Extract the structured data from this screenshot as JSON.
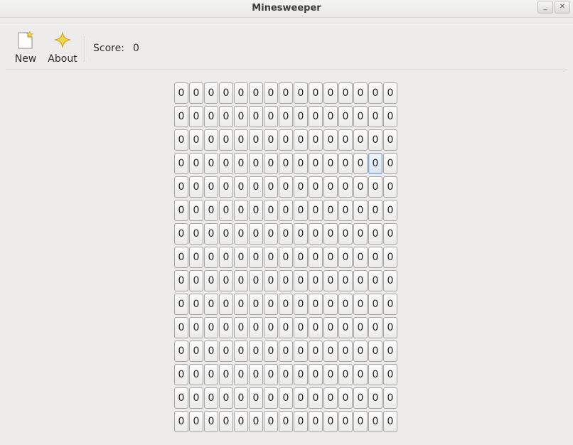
{
  "window": {
    "title": "Minesweeper"
  },
  "toolbar": {
    "new_label": "New",
    "about_label": "About",
    "score_label": "Score:",
    "score_value": "0"
  },
  "board": {
    "rows": 15,
    "cols": 15,
    "cell_text": "0",
    "focused_cell": {
      "row": 3,
      "col": 13
    }
  },
  "icons": {
    "new": "new-document-icon",
    "about": "star-icon"
  }
}
